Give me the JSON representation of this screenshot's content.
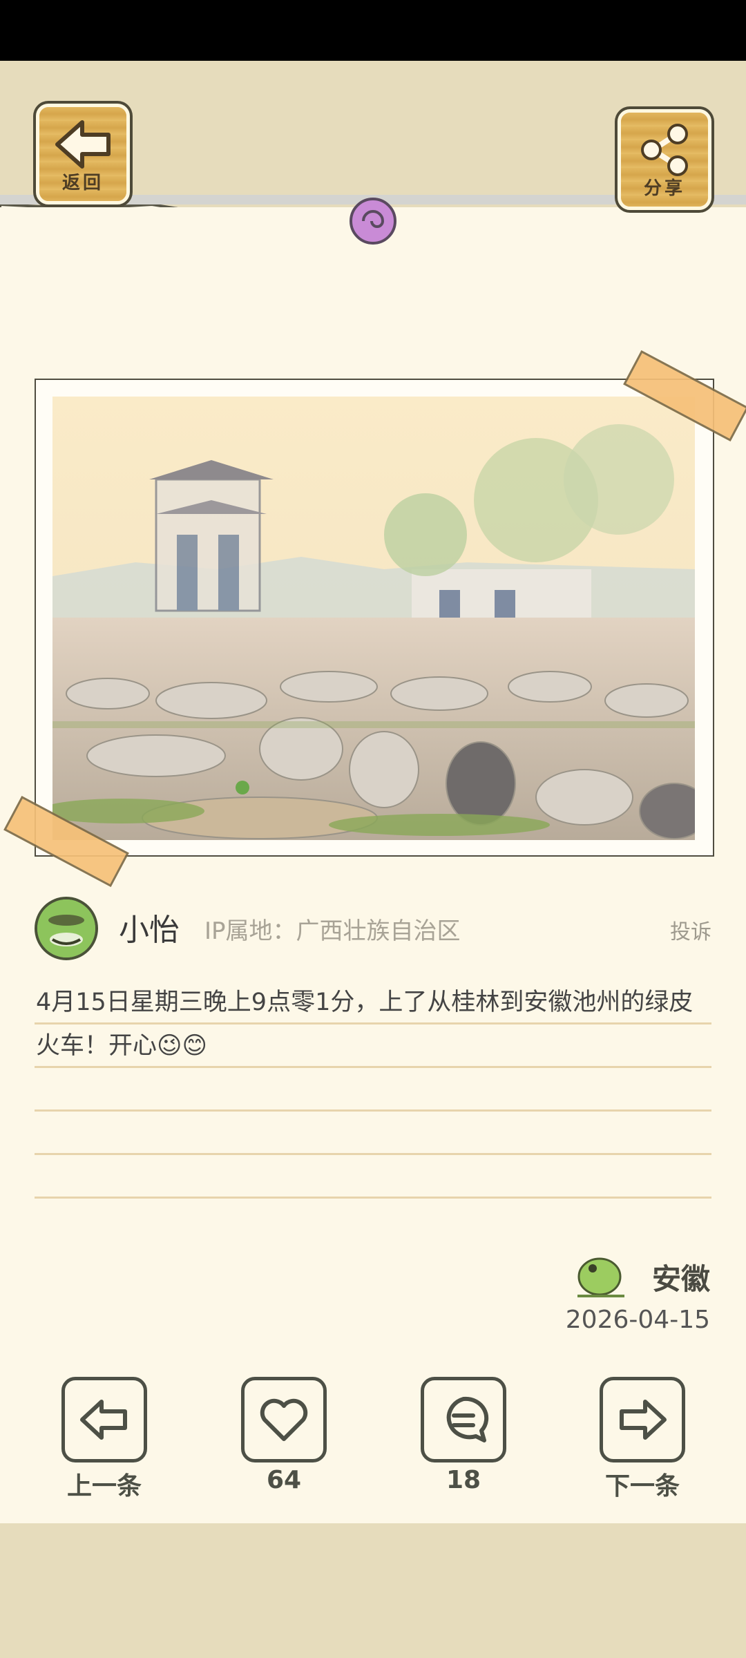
{
  "header": {
    "back_label": "返回",
    "share_label": "分享"
  },
  "post": {
    "user_name": "小怡",
    "ip_location": "IP属地：广西壮族自治区",
    "report_label": "投诉",
    "content": "4月15日星期三晚上9点零1分，上了从桂林到安徽池州的绿皮火车！开心😉😊",
    "location": "安徽",
    "date": "2026-04-15"
  },
  "bottom_nav": {
    "prev_label": "上一条",
    "like_count": "64",
    "comment_count": "18",
    "next_label": "下一条"
  },
  "colors": {
    "paper": "#fdf8e8",
    "background": "#e6dcbc",
    "wood": "#dcae54",
    "icon_dark": "#4d5046",
    "tape": "#f6c078"
  }
}
